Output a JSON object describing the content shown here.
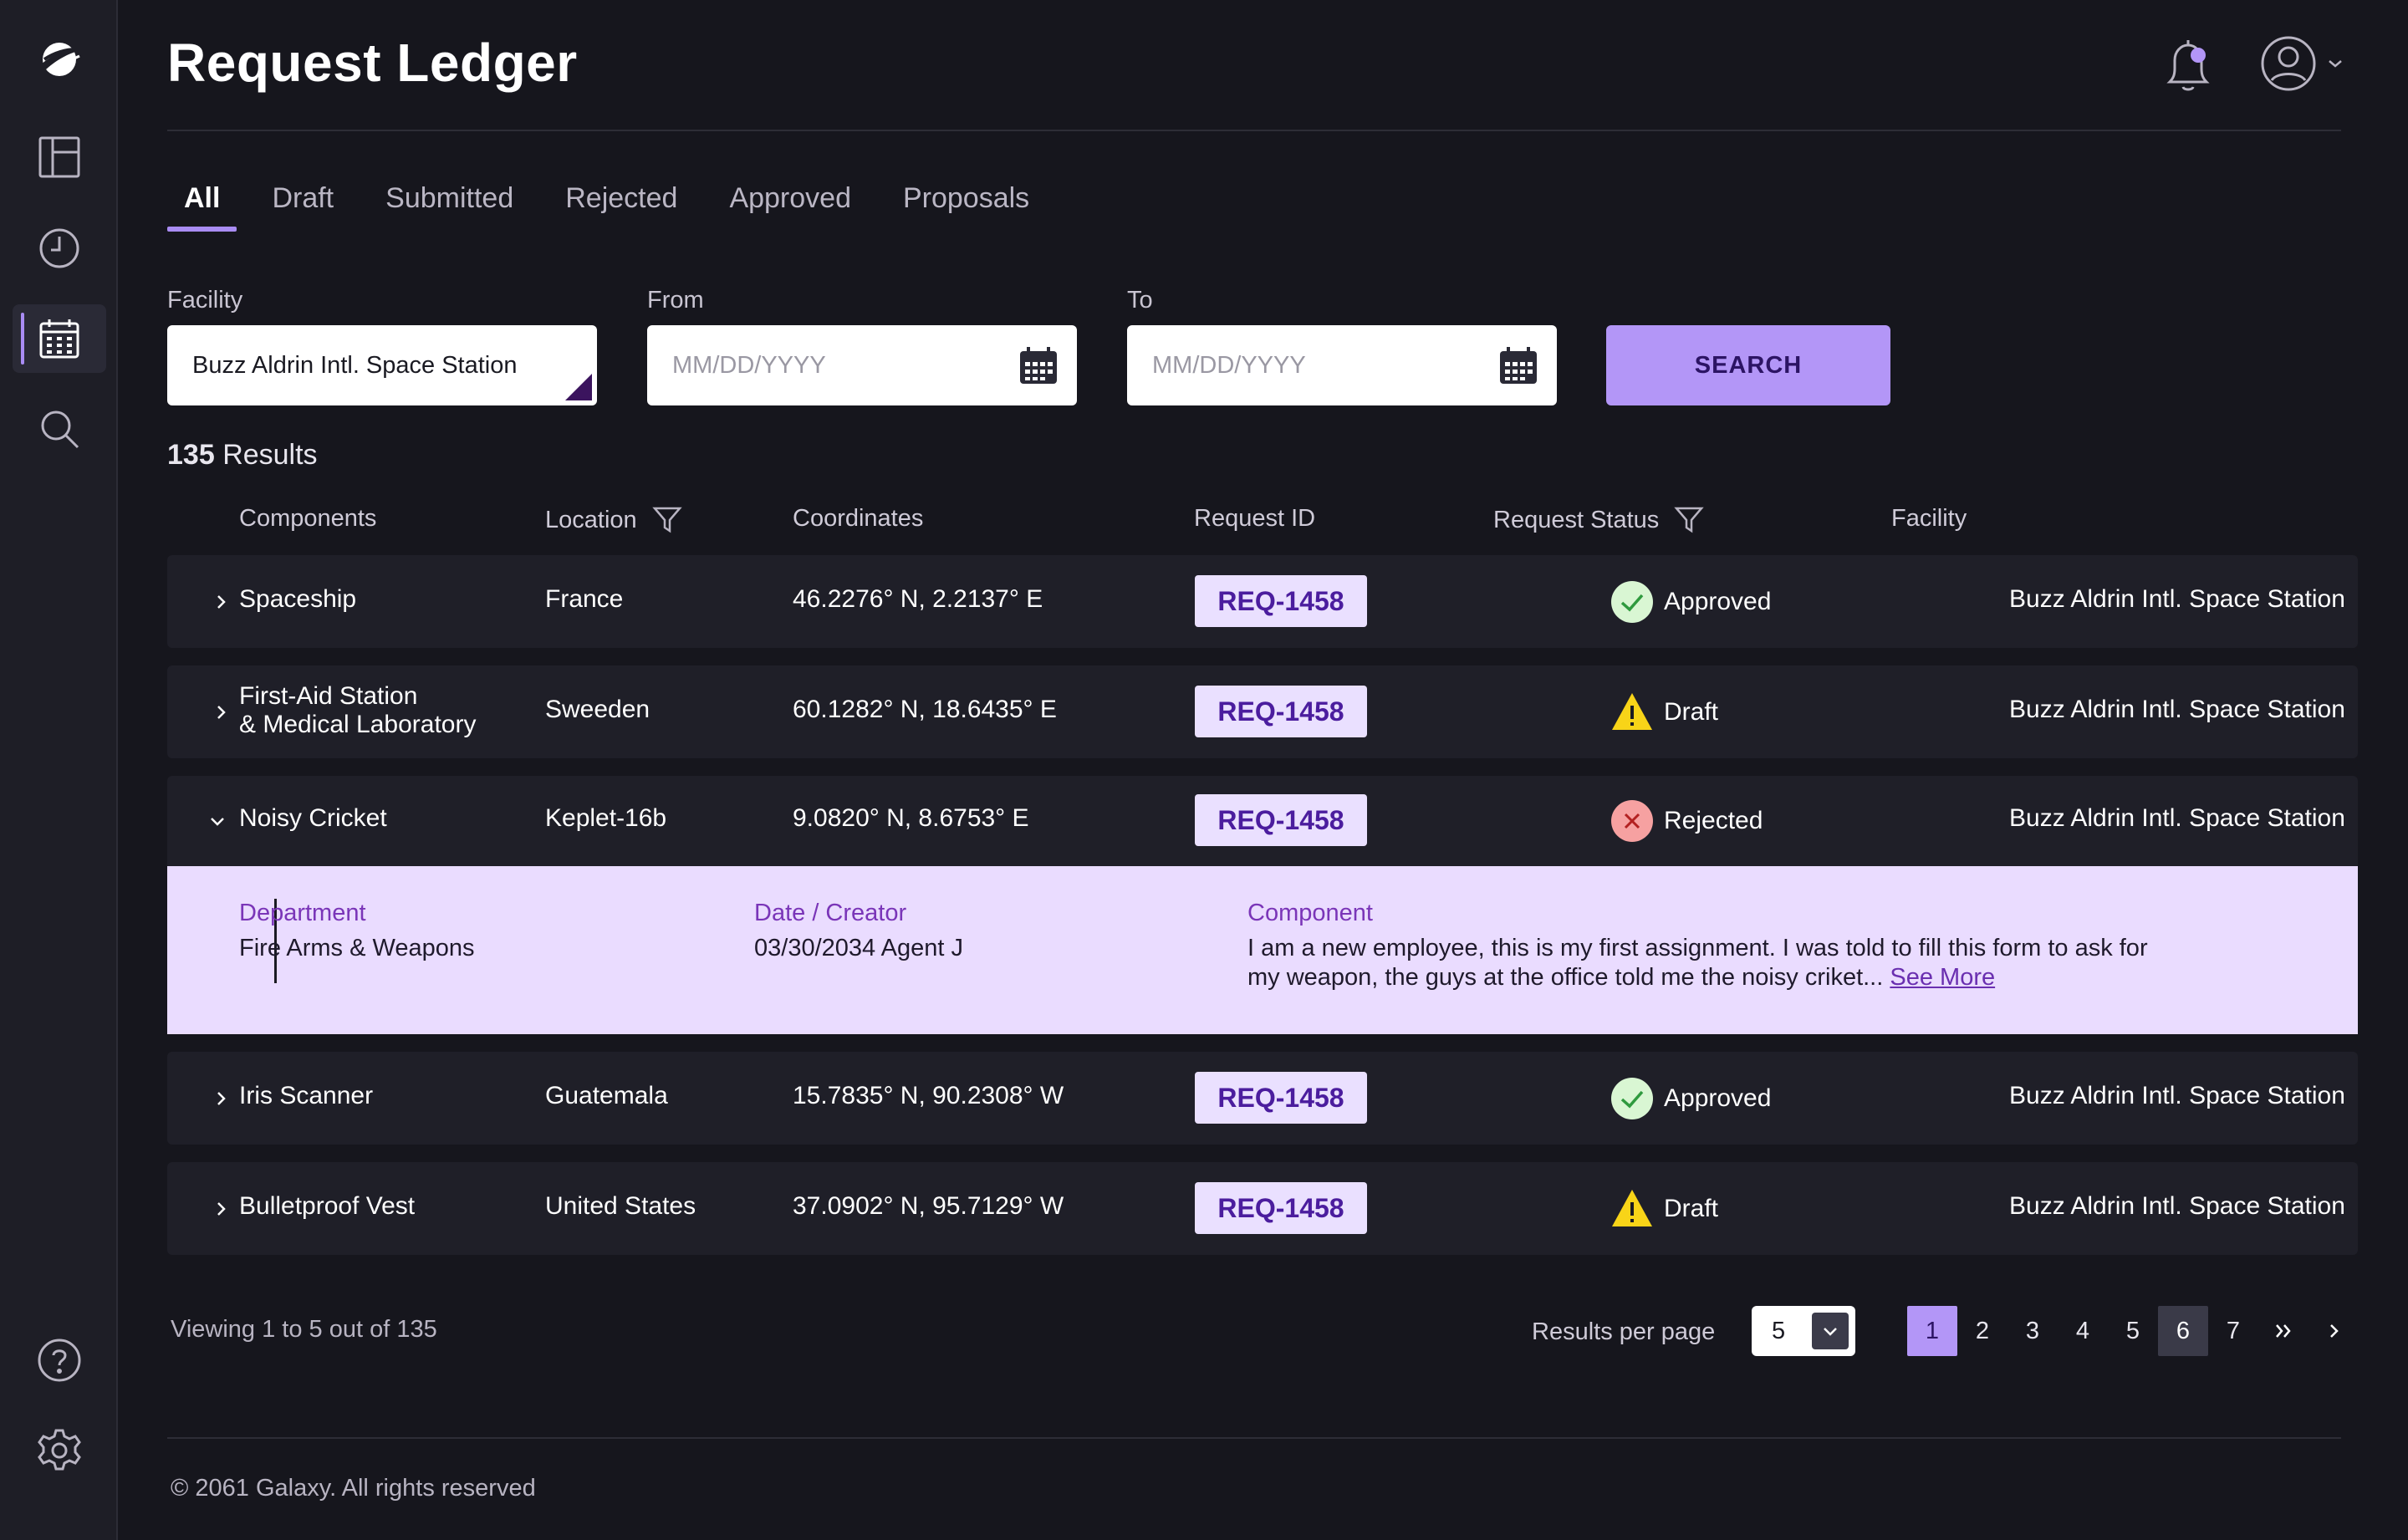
{
  "app": {
    "title": "Request Ledger",
    "accent_color": "#b396f7",
    "notification_dot_color": "#b396f7"
  },
  "sidebar": {
    "items": [
      {
        "name": "logo",
        "icon": "galaxy-logo-icon"
      },
      {
        "name": "dashboard",
        "icon": "layout-icon"
      },
      {
        "name": "history",
        "icon": "clock-icon"
      },
      {
        "name": "calendar",
        "icon": "calendar-icon",
        "active": true
      },
      {
        "name": "search",
        "icon": "search-icon"
      },
      {
        "name": "help",
        "icon": "help-icon"
      },
      {
        "name": "settings",
        "icon": "gear-icon"
      }
    ]
  },
  "tabs": [
    {
      "label": "All",
      "active": true
    },
    {
      "label": "Draft"
    },
    {
      "label": "Submitted"
    },
    {
      "label": "Rejected"
    },
    {
      "label": "Approved"
    },
    {
      "label": "Proposals"
    }
  ],
  "filters": {
    "facility_label": "Facility",
    "facility_value": "Buzz Aldrin Intl. Space Station",
    "from_label": "From",
    "from_placeholder": "MM/DD/YYYY",
    "to_label": "To",
    "to_placeholder": "MM/DD/YYYY",
    "search_label": "SEARCH"
  },
  "results": {
    "count": "135",
    "label": "Results"
  },
  "table": {
    "headers": {
      "components": "Components",
      "location": "Location",
      "coordinates": "Coordinates",
      "request_id": "Request ID",
      "request_status": "Request Status",
      "facility": "Facility"
    },
    "rows": [
      {
        "component": "Spaceship",
        "component2": "",
        "location": "France",
        "coordinates": "46.2276° N, 2.2137° E",
        "request_id": "REQ-1458",
        "status": "Approved",
        "facility": "Buzz Aldrin Intl. Space Station"
      },
      {
        "component": "First-Aid Station",
        "component2": "& Medical Laboratory",
        "location": "Sweeden",
        "coordinates": "60.1282° N, 18.6435° E",
        "request_id": "REQ-1458",
        "status": "Draft",
        "facility": "Buzz Aldrin Intl. Space Station"
      },
      {
        "component": "Noisy Cricket",
        "component2": "",
        "location": "Keplet-16b",
        "coordinates": "9.0820° N, 8.6753° E",
        "request_id": "REQ-1458",
        "status": "Rejected",
        "facility": "Buzz Aldrin Intl. Space Station",
        "expanded": true
      },
      {
        "component": "Iris Scanner",
        "component2": "",
        "location": "Guatemala",
        "coordinates": "15.7835° N, 90.2308° W",
        "request_id": "REQ-1458",
        "status": "Approved",
        "facility": "Buzz Aldrin Intl. Space Station"
      },
      {
        "component": "Bulletproof Vest",
        "component2": "",
        "location": "United States",
        "coordinates": "37.0902° N, 95.7129° W",
        "request_id": "REQ-1458",
        "status": "Draft",
        "facility": "Buzz Aldrin Intl. Space Station"
      }
    ],
    "detail": {
      "department_label": "Department",
      "department_value": "Fire Arms & Weapons",
      "date_label": "Date / Creator",
      "date_value": "03/30/2034 Agent J",
      "component_label": "Component",
      "component_line1": "I am a new employee, this is my first assignment. I was told to fill this form to ask for",
      "component_line2": "my weapon, the guys at the office told me the noisy criket...",
      "see_more": "See More"
    }
  },
  "pagination": {
    "viewing": "Viewing 1 to 5 out of 135",
    "rpp_label": "Results per page",
    "rpp_value": "5",
    "pages": [
      "1",
      "2",
      "3",
      "4",
      "5",
      "6",
      "7"
    ],
    "current_page": "1",
    "hover_page": "6"
  },
  "footer": {
    "copyright": "© 2061 Galaxy. All rights reserved"
  }
}
